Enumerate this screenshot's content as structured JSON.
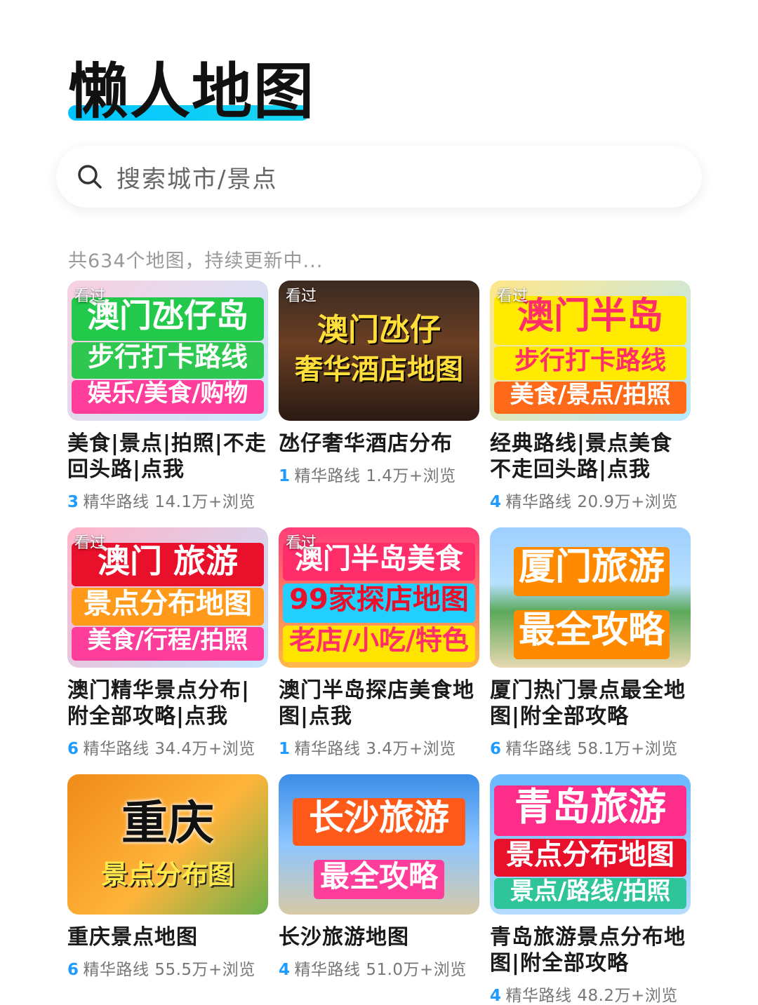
{
  "app_title": "懒人地图",
  "search": {
    "placeholder": "搜索城市/景点"
  },
  "count_text": "共634个地图，持续更新中...",
  "cards": [
    {
      "seen": "看过",
      "lines": [
        "澳门氹仔岛",
        "步行打卡路线",
        "娱乐/美食/购物"
      ],
      "title": "美食|景点|拍照|不走回头路|点我",
      "route_count": "3",
      "route_label": "精华路线",
      "views": "14.1万+浏览"
    },
    {
      "seen": "看过",
      "lines": [
        "澳门氹仔",
        "奢华酒店地图"
      ],
      "title": "氹仔奢华酒店分布",
      "route_count": "1",
      "route_label": "精华路线",
      "views": "1.4万+浏览"
    },
    {
      "seen": "看过",
      "lines": [
        "澳门半岛",
        "步行打卡路线",
        "美食/景点/拍照"
      ],
      "title": "经典路线|景点美食不走回头路|点我",
      "route_count": "4",
      "route_label": "精华路线",
      "views": "20.9万+浏览"
    },
    {
      "seen": "看过",
      "lines": [
        "澳门  旅游",
        "景点分布地图",
        "美食/行程/拍照"
      ],
      "title": "澳门精华景点分布|附全部攻略|点我",
      "route_count": "6",
      "route_label": "精华路线",
      "views": "34.4万+浏览"
    },
    {
      "seen": "看过",
      "lines": [
        "澳门半岛美食",
        "99家探店地图",
        "老店/小吃/特色"
      ],
      "title": "澳门半岛探店美食地图|点我",
      "route_count": "1",
      "route_label": "精华路线",
      "views": "3.4万+浏览"
    },
    {
      "seen": "",
      "lines": [
        "厦门旅游",
        "最全攻略"
      ],
      "title": "厦门热门景点最全地图|附全部攻略",
      "route_count": "6",
      "route_label": "精华路线",
      "views": "58.1万+浏览"
    },
    {
      "seen": "",
      "lines": [
        "重庆",
        "景点分布图"
      ],
      "title": "重庆景点地图",
      "route_count": "6",
      "route_label": "精华路线",
      "views": "55.5万+浏览"
    },
    {
      "seen": "",
      "lines": [
        "长沙旅游",
        "最全攻略"
      ],
      "title": "长沙旅游地图",
      "route_count": "4",
      "route_label": "精华路线",
      "views": "51.0万+浏览"
    },
    {
      "seen": "",
      "lines": [
        "青岛旅游",
        "景点分布地图",
        "景点/路线/拍照"
      ],
      "title": "青岛旅游景点分布地图|附全部攻略",
      "route_count": "4",
      "route_label": "精华路线",
      "views": "48.2万+浏览"
    }
  ],
  "colors": {
    "accent": "#1e9bff",
    "title_underline": "#00c4ff"
  }
}
